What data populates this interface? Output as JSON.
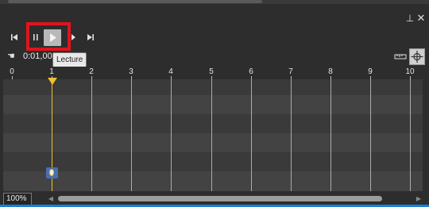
{
  "window": {
    "pin_icon": "pin-icon",
    "close_icon": "close-icon"
  },
  "transport": {
    "goto_start_icon": "skip-to-start-icon",
    "pause_icon": "pause-icon",
    "play_icon": "play-icon",
    "step_forward_icon": "step-forward-icon",
    "goto_end_icon": "skip-to-end-icon",
    "tooltip": "Lecture"
  },
  "toolbar": {
    "time": "0:01,00",
    "hand_icon": "hand-icon",
    "ruler_icon": "ruler-icon",
    "crosshair_icon": "crosshair-icon"
  },
  "ruler": {
    "ticks": [
      "0",
      "1",
      "2",
      "3",
      "4",
      "5",
      "6",
      "7",
      "8",
      "9",
      "10"
    ]
  },
  "timeline": {
    "playhead_time": 1,
    "keyframe_time": 1
  },
  "footer": {
    "zoom": "100%"
  },
  "colors": {
    "playhead": "#f0c030",
    "highlight": "#e0141e",
    "keyframe": "#4a6fb0"
  }
}
